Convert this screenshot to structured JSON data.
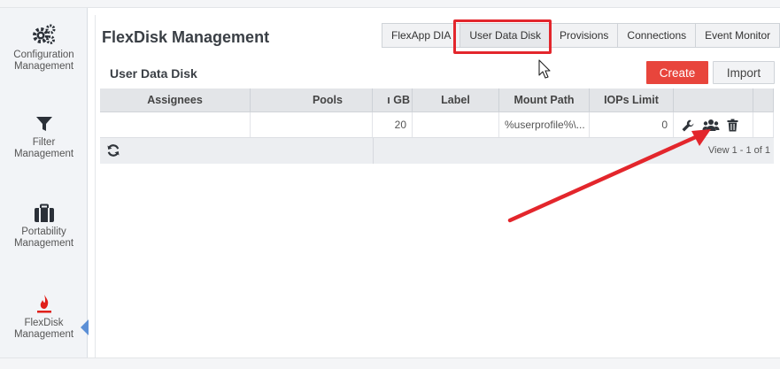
{
  "sidebar": {
    "items": [
      {
        "label_line1": "Configuration",
        "label_line2": "Management",
        "icon": "gears-icon"
      },
      {
        "label_line1": "Filter",
        "label_line2": "Management",
        "icon": "filter-icon"
      },
      {
        "label_line1": "Portability",
        "label_line2": "Management",
        "icon": "briefcase-icon"
      },
      {
        "label_line1": "FlexDisk",
        "label_line2": "Management",
        "icon": "flame-icon",
        "active": true
      }
    ]
  },
  "header": {
    "title": "FlexDisk Management"
  },
  "tabs": [
    {
      "label": "FlexApp DIA"
    },
    {
      "label": "User Data Disk",
      "active": true
    },
    {
      "label": "Provisions"
    },
    {
      "label": "Connections"
    },
    {
      "label": "Event Monitor"
    }
  ],
  "section": {
    "title": "User Data Disk",
    "create_label": "Create",
    "import_label": "Import"
  },
  "grid": {
    "columns": [
      "Assignees",
      "Pools",
      "ı GB",
      "Label",
      "Mount Path",
      "IOPs Limit",
      "",
      ""
    ],
    "rows": [
      {
        "assignees": "",
        "pools": "",
        "size_gb": "20",
        "label": "",
        "mount_path": "%userprofile%\\...",
        "iops_limit": "0"
      }
    ],
    "pager_text": "View 1 - 1 of 1"
  },
  "colors": {
    "accent_red": "#e8453c",
    "annotation_red": "#e3262c",
    "flame_red": "#e0201b",
    "active_marker": "#5b8fd6"
  }
}
